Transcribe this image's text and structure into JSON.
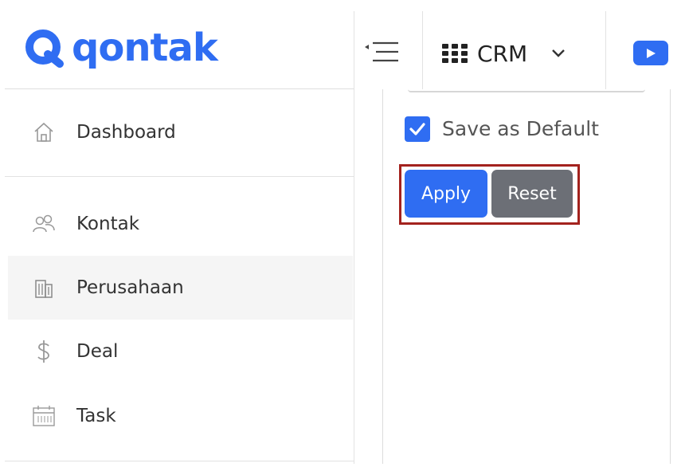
{
  "brand": {
    "logo_text": "qontak",
    "color": "#2f6df2"
  },
  "header": {
    "menu_toggle_icon": "collapse-menu-icon",
    "app_switcher": {
      "icon": "grid-icon",
      "label": "CRM",
      "chevron": "chevron-down-icon"
    },
    "video_icon": "youtube-play-icon"
  },
  "sidebar": {
    "items": [
      {
        "label": "Dashboard",
        "icon": "home-icon",
        "active": false
      },
      {
        "label": "Kontak",
        "icon": "contacts-icon",
        "active": false
      },
      {
        "label": "Perusahaan",
        "icon": "building-icon",
        "active": true
      },
      {
        "label": "Deal",
        "icon": "dollar-icon",
        "active": false
      },
      {
        "label": "Task",
        "icon": "calendar-icon",
        "active": false
      }
    ]
  },
  "filter_panel": {
    "save_default": {
      "label": "Save as Default",
      "checked": true
    },
    "apply_label": "Apply",
    "reset_label": "Reset",
    "highlight_color": "#a3221e"
  }
}
